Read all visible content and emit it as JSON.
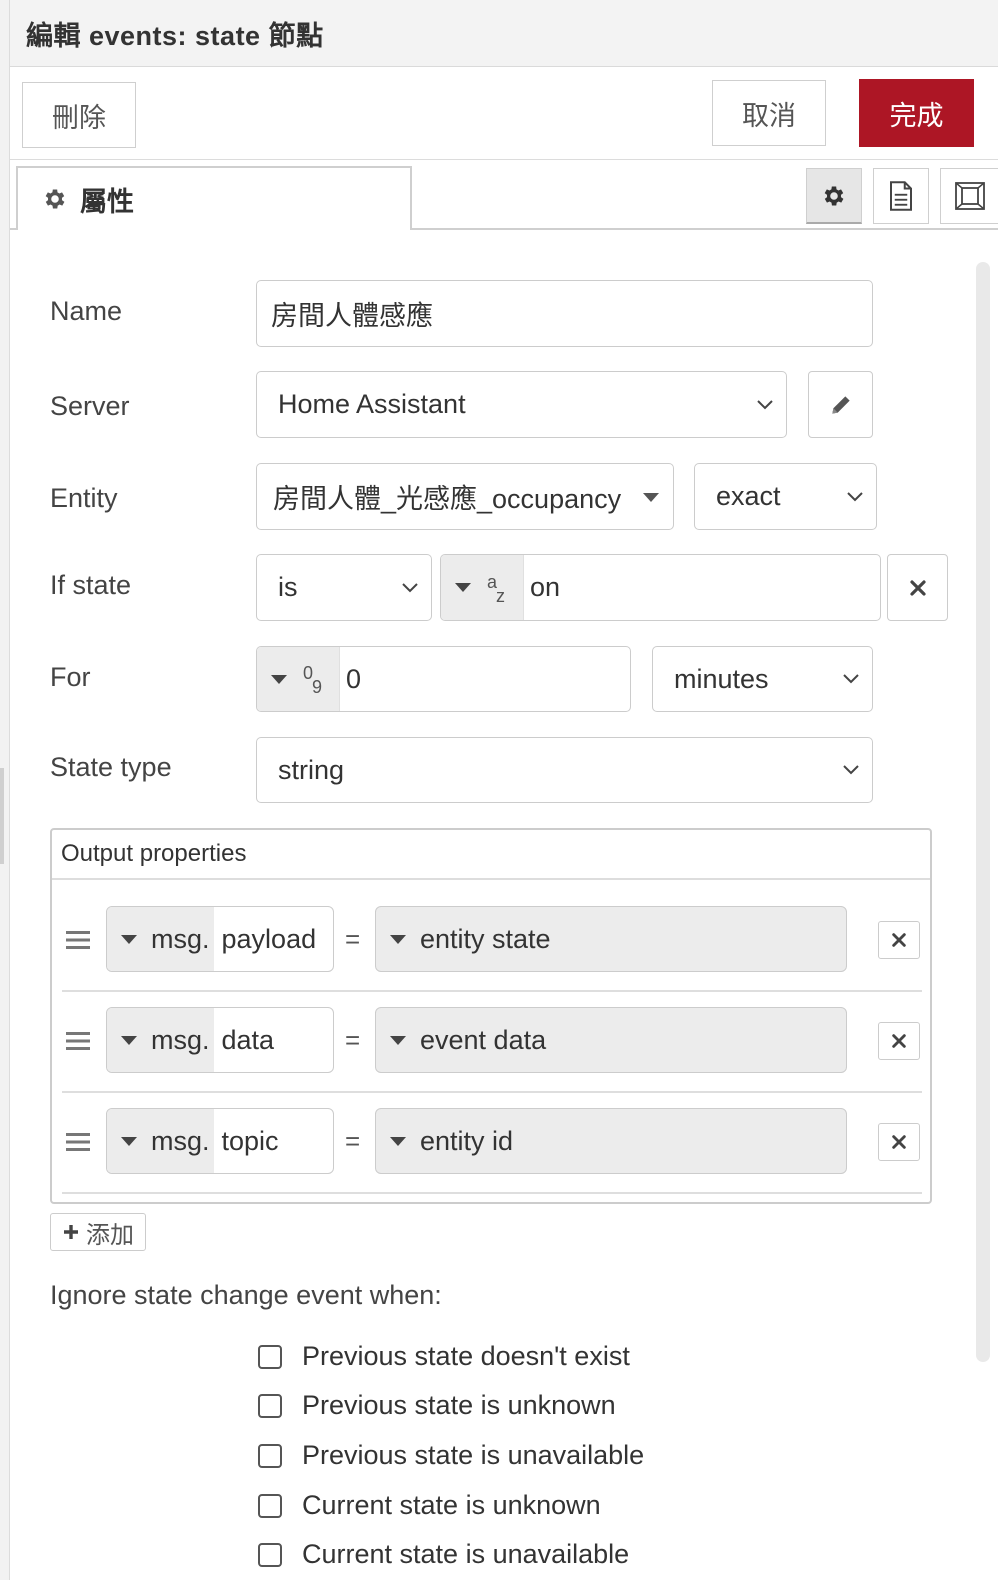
{
  "dialog": {
    "title": "編輯 events: state 節點",
    "delete_label": "刪除",
    "cancel_label": "取消",
    "done_label": "完成",
    "done_color": "#ad1625"
  },
  "tabs": {
    "properties_label": "屬性",
    "icons": [
      "gear-icon",
      "document-icon",
      "frame-icon"
    ]
  },
  "form": {
    "name": {
      "label": "Name",
      "value": "房間人體感應"
    },
    "server": {
      "label": "Server",
      "value": "Home Assistant"
    },
    "entity": {
      "label": "Entity",
      "value": "房間人體_光感應_occupancy",
      "match": "exact"
    },
    "if_state": {
      "label": "If state",
      "operator": "is",
      "type_glyph_top": "a",
      "type_glyph_bottom": "z",
      "value": "on"
    },
    "for": {
      "label": "For",
      "type_glyph_top": "0",
      "type_glyph_bottom": "9",
      "value": "0",
      "unit": "minutes"
    },
    "state_type": {
      "label": "State type",
      "value": "string"
    }
  },
  "output": {
    "title": "Output properties",
    "rows": [
      {
        "prefix": "msg.",
        "property": "payload",
        "equals": "=",
        "value": "entity state"
      },
      {
        "prefix": "msg.",
        "property": "data",
        "equals": "=",
        "value": "event data"
      },
      {
        "prefix": "msg.",
        "property": "topic",
        "equals": "=",
        "value": "entity id"
      }
    ],
    "add_label": "添加"
  },
  "ignore": {
    "title": "Ignore state change event when:",
    "options": [
      {
        "label": "Previous state doesn't exist",
        "checked": false
      },
      {
        "label": "Previous state is unknown",
        "checked": false
      },
      {
        "label": "Previous state is unavailable",
        "checked": false
      },
      {
        "label": "Current state is unknown",
        "checked": false
      },
      {
        "label": "Current state is unavailable",
        "checked": false
      }
    ]
  }
}
